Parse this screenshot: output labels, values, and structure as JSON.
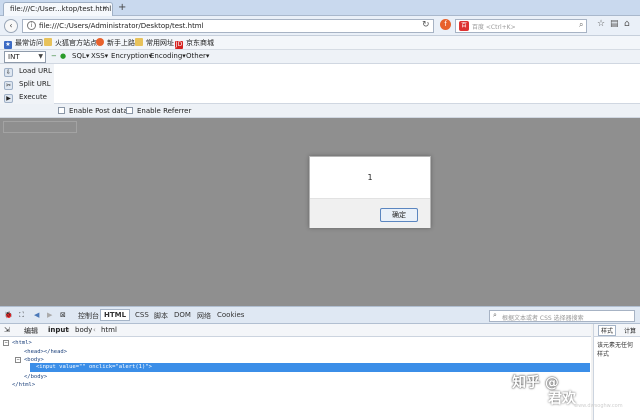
{
  "browser": {
    "tab_title": "file:///C:/User...ktop/test.html",
    "url": "file:///C:/Users/Administrator/Desktop/test.html",
    "search_placeholder": "百度 <Ctrl+K>",
    "bookmarks": [
      {
        "label": "最常访问",
        "icon": "star-folder-icon",
        "color": "#3c6bc4"
      },
      {
        "label": "火狐官方站点",
        "icon": "folder-icon",
        "color": "#e8c25a"
      },
      {
        "label": "新手上路",
        "icon": "firefox-icon",
        "color": "#e8612c"
      },
      {
        "label": "常用网址",
        "icon": "folder-icon",
        "color": "#e8c25a"
      },
      {
        "label": "京东商城",
        "icon": "jd-icon",
        "color": "#d5221f"
      }
    ]
  },
  "hackbar": {
    "type_select": "INT",
    "menu": [
      "SQL▾",
      "XSS▾",
      "Encryption▾",
      "Encoding▾",
      "Other▾"
    ],
    "actions": [
      "Load URL",
      "Split URL",
      "Execute"
    ],
    "options": [
      "Enable Post data",
      "Enable Referrer"
    ]
  },
  "dialog": {
    "message": "1",
    "ok_label": "确定"
  },
  "devtools": {
    "tabs": [
      "控制台",
      "HTML",
      "CSS",
      "脚本",
      "DOM",
      "网络",
      "Cookies"
    ],
    "active_tab": "HTML",
    "search_placeholder": "根据文本或者 CSS 选择器搜索",
    "edit_label": "编辑",
    "breadcrumb": [
      "input",
      "body",
      "html"
    ],
    "side_tabs": [
      "样式",
      "计算"
    ],
    "side_text": "该元素无任何样式",
    "tree": {
      "html_open": "<html>",
      "head": "<head></head>",
      "body_open": "<body>",
      "selected": "<input value=\"\" onclick=\"alert(1)\">",
      "body_close": "</body>",
      "html_close": "</html>"
    }
  },
  "watermark": {
    "main": "知乎 @",
    "sub": "君欢",
    "url": "www.dwsoghw.com"
  }
}
